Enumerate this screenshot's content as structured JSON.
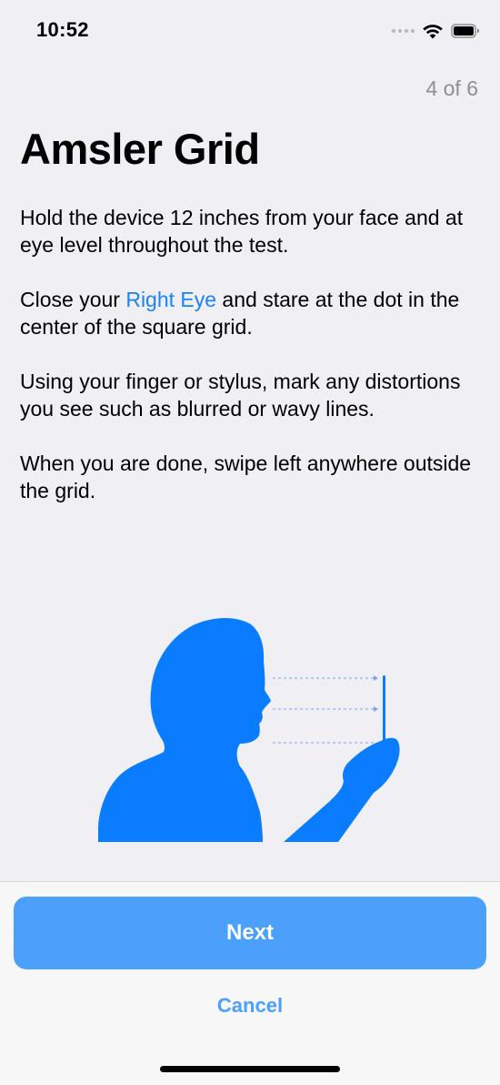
{
  "status_bar": {
    "time": "10:52"
  },
  "progress": {
    "step_label": "4 of 6",
    "current_step": 4,
    "total_steps": 6
  },
  "page": {
    "title": "Amsler Grid",
    "instructions": {
      "p1": "Hold the device 12 inches from your face and at eye level throughout the test.",
      "p2_before": "Close your ",
      "p2_highlight": "Right Eye",
      "p2_after": " and stare at the dot in the center of the square grid.",
      "p3": "Using your finger or stylus, mark any distortions you see such as blurred or wavy lines.",
      "p4": "When you are done, swipe left anywhere outside the grid."
    }
  },
  "illustration": {
    "icon": "person-holding-device-illustration",
    "color": "#0a7cff"
  },
  "actions": {
    "next_label": "Next",
    "cancel_label": "Cancel"
  },
  "colors": {
    "accent": "#1a82fb",
    "button": "#4aa0fb",
    "background": "#efeff4"
  }
}
